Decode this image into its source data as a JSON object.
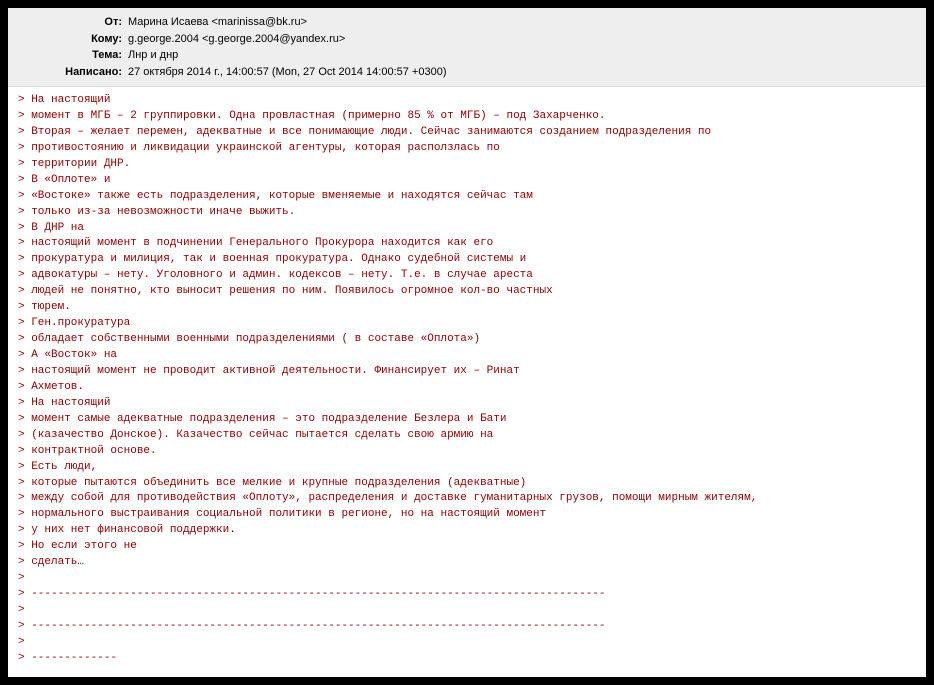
{
  "header": {
    "labels": {
      "from": "От:",
      "to": "Кому:",
      "subject": "Тема:",
      "date": "Написано:"
    },
    "from": "Марина Исаева <marinissa@bk.ru>",
    "to": "g.george.2004 <g.george.2004@yandex.ru>",
    "subject": "Лнр и днр",
    "date": "27 октября 2014 г., 14:00:57  (Mon, 27 Oct 2014 14:00:57 +0300)"
  },
  "body_lines": [
    "> На настоящий",
    "> момент в МГБ – 2 группировки. Одна провластная (примерно 85 % от МГБ) – под Захарченко.",
    "> Вторая – желает перемен, адекватные и все понимающие люди.    Сейчас занимаются созданием подразделения по",
    "> противостоянию и ликвидации украинской агентуры, которая расползлась по",
    "> территории ДНР.",
    "> В «Оплоте» и",
    "> «Востоке» также есть подразделения, которые вменяемые и находятся сейчас там",
    "> только из-за невозможности иначе выжить.",
    "> В ДНР на",
    "> настоящий момент в подчинении Генерального Прокурора находится как его",
    "> прокуратура и милиция, так и военная прокуратура. Однако судебной системы и",
    "> адвокатуры – нету. Уголовного и админ. кодексов – нету. Т.е. в случае ареста",
    "> людей не понятно, кто выносит решения по ним. Появилось огромное кол-во частных",
    "> тюрем.",
    "> Ген.прокуратура",
    "> обладает собственными военными подразделениями ( в составе «Оплота»)",
    "> А «Восток» на",
    "> настоящий момент не проводит активной деятельности. Финансирует их – Ринат",
    "> Ахметов.",
    "> На настоящий",
    "> момент самые адекватные подразделения – это подразделение Безлера и Бати",
    "> (казачество Донское). Казачество сейчас пытается сделать свою армию на",
    "> контрактной основе.",
    "> Есть люди,",
    "> которые пытаются объединить все мелкие и крупные подразделения (адекватные)",
    "> между собой для противодействия «Оплоту»,   распределения и доставке гуманитарных грузов, помощи мирным жителям,",
    "> нормального выстраивания социальной политики в регионе, но на настоящий момент",
    "> у них нет финансовой поддержки.",
    "> Но если этого не",
    "> сделать…",
    ">",
    "> ---------------------------------------------------------------------------------------",
    ">",
    "> ---------------------------------------------------------------------------------------",
    ">",
    "> -------------"
  ]
}
